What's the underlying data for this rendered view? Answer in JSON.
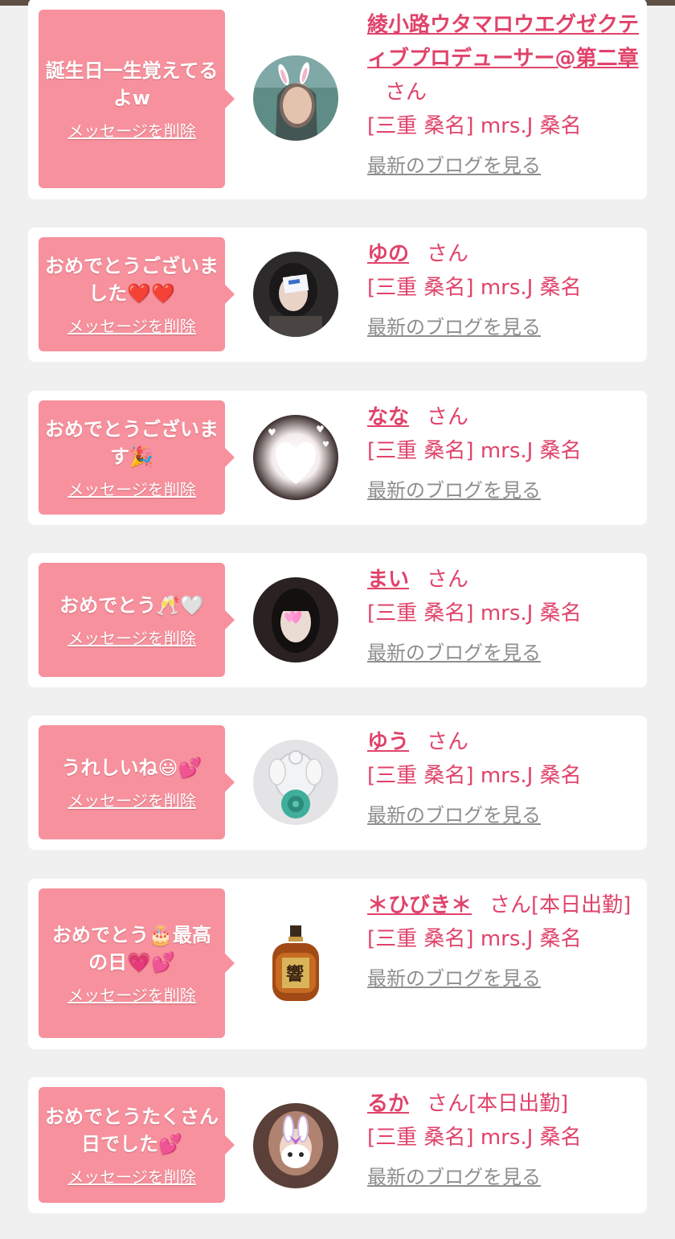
{
  "colors": {
    "background": "#f1f0f0",
    "card": "#ffffff",
    "bubble": "#f7919d",
    "accent": "#e0436a",
    "link_gray": "#8e8e8e",
    "top_bar": "#5e4f45"
  },
  "common": {
    "delete_label": "メッセージを削除",
    "san": "さん",
    "blog_label": "最新のブログを見る"
  },
  "entries": [
    {
      "message": "誕生日一生覚えてるよw",
      "name": "綾小路ウタマロウエグゼクティブプロデューサー@第二章",
      "status": "",
      "shop": "[三重 桑名] mrs.J 桑名",
      "avatar": "woman-bunny-ears-photo"
    },
    {
      "message": "おめでとうございました❤️❤️",
      "name": "ゆの",
      "status": "",
      "shop": "[三重 桑名] mrs.J 桑名",
      "avatar": "woman-holding-card-photo"
    },
    {
      "message": "おめでとうございます🎉",
      "name": "なな",
      "status": "",
      "shop": "[三重 桑名] mrs.J 桑名",
      "avatar": "heart-blur-photo"
    },
    {
      "message": "おめでとう🥂🤍",
      "name": "まい",
      "status": "",
      "shop": "[三重 桑名] mrs.J 桑名",
      "avatar": "woman-heart-face-photo"
    },
    {
      "message": "うれしいね😃💕",
      "name": "ゆう",
      "status": "",
      "shop": "[三重 桑名] mrs.J 桑名",
      "avatar": "glass-angel-rose-photo"
    },
    {
      "message": "おめでとう🎂最高の日💗💕",
      "name": "＊ひびき＊",
      "status": "[本日出勤]",
      "shop": "[三重 桑名] mrs.J 桑名",
      "avatar": "whisky-bottle-photo"
    },
    {
      "message": "おめでとうたくさん日でした💕",
      "name": "るか",
      "status": "[本日出勤]",
      "shop": "[三重 桑名] mrs.J 桑名",
      "avatar": "woman-bunny-filter-photo"
    }
  ]
}
